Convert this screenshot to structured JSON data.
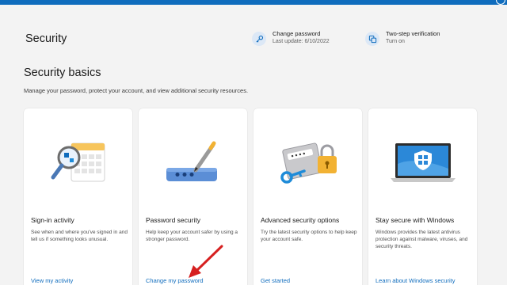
{
  "header": {
    "page_title": "Security",
    "quick_actions": [
      {
        "title": "Change password",
        "subtitle": "Last update: 6/10/2022",
        "icon": "key-icon"
      },
      {
        "title": "Two-step verification",
        "subtitle": "Turn on",
        "icon": "two-step-icon"
      }
    ]
  },
  "main": {
    "section_title": "Security basics",
    "section_description": "Manage your password, protect your account, and view additional security resources.",
    "cards": [
      {
        "title": "Sign-in activity",
        "description": "See when and where you've signed in and tell us if something looks unusual.",
        "link": "View my activity",
        "illustration": "magnifier-calendar-illustration"
      },
      {
        "title": "Password security",
        "description": "Help keep your account safer by using a stronger password.",
        "link": "Change my password",
        "illustration": "password-pen-illustration"
      },
      {
        "title": "Advanced security options",
        "description": "Try the latest security options to help keep your account safe.",
        "link": "Get started",
        "illustration": "lock-key-illustration"
      },
      {
        "title": "Stay secure with Windows",
        "description": "Windows provides the latest antivirus protection against malware, viruses, and security threats.",
        "link": "Learn about Windows security",
        "illustration": "laptop-shield-illustration"
      }
    ]
  },
  "colors": {
    "accent": "#0f6cbd",
    "background": "#f3f3f3",
    "annotation_arrow": "#d62020"
  }
}
